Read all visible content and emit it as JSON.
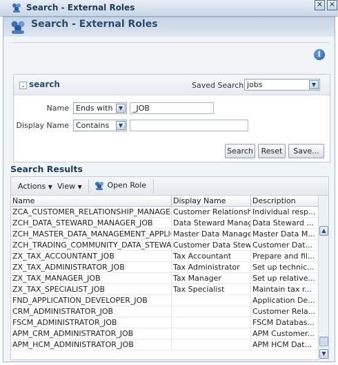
{
  "window": {
    "title": "Search - External Roles",
    "icon": "roles-icon",
    "close_glyph": "✕"
  },
  "dialog": {
    "heading": "Search - External Roles",
    "info_glyph": "i"
  },
  "search": {
    "title": "search",
    "disclosure_glyph": "⌄",
    "saved_search_label": "Saved Search",
    "saved_search_value": "jobs",
    "name_label": "Name",
    "name_operator": "Ends with",
    "name_value": "_JOB",
    "display_name_label": "Display Name",
    "display_name_operator": "Contains",
    "display_name_value": "",
    "search_button": "Search",
    "reset_button": "Reset",
    "save_button": "Save..."
  },
  "results": {
    "title": "Search Results",
    "toolbar": {
      "actions": "Actions",
      "view": "View",
      "open_role": "Open Role"
    },
    "columns": [
      "Name",
      "Display Name",
      "Description"
    ],
    "rows": [
      [
        "ZCA_CUSTOMER_RELATIONSHIP_MANAGEM...",
        "Customer Relationsh...",
        "Individual resp..."
      ],
      [
        "ZCH_DATA_STEWARD_MANAGER_JOB",
        "Data Steward Manager",
        "Data Steward ..."
      ],
      [
        "ZCH_MASTER_DATA_MANAGEMENT_APPLIC...",
        "Master Data Manage...",
        "Master Data M..."
      ],
      [
        "ZCH_TRADING_COMMUNITY_DATA_STEWA...",
        "Customer Data Stew...",
        "Customer Dat..."
      ],
      [
        "ZX_TAX_ACCOUNTANT_JOB",
        "Tax Accountant",
        "Prepare and fil..."
      ],
      [
        "ZX_TAX_ADMINISTRATOR_JOB",
        "Tax Administrator",
        "Set up technic..."
      ],
      [
        "ZX_TAX_MANAGER_JOB",
        "Tax Manager",
        "Set up relative..."
      ],
      [
        "ZX_TAX_SPECIALIST_JOB",
        "Tax Specialist",
        "Maintain tax r..."
      ],
      [
        "FND_APPLICATION_DEVELOPER_JOB",
        "",
        "Application De..."
      ],
      [
        "CRM_ADMINISTRATOR_JOB",
        "",
        "Customer Rela..."
      ],
      [
        "FSCM_ADMINISTRATOR_JOB",
        "",
        "FSCM Databas..."
      ],
      [
        "APM_CRM_ADMINISTRATOR_JOB",
        "",
        "APM Customer..."
      ],
      [
        "APM_HCM_ADMINISTRATOR_JOB",
        "",
        "APM HCM Dat..."
      ]
    ]
  },
  "colors": {
    "accent": "#2a4a6e",
    "panel_bg": "#f2f5f8"
  }
}
